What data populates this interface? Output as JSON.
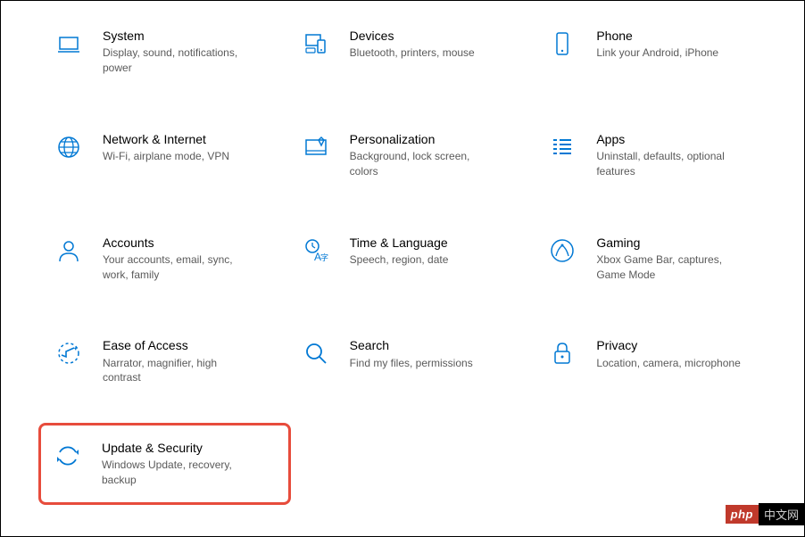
{
  "colors": {
    "iconBlue": "#0078d4",
    "highlightRed": "#e74c3c"
  },
  "watermark": {
    "left": "php",
    "right": "中文网"
  },
  "categories": [
    {
      "id": "system",
      "icon": "system-icon",
      "title": "System",
      "subtitle": "Display, sound, notifications, power"
    },
    {
      "id": "devices",
      "icon": "devices-icon",
      "title": "Devices",
      "subtitle": "Bluetooth, printers, mouse"
    },
    {
      "id": "phone",
      "icon": "phone-icon",
      "title": "Phone",
      "subtitle": "Link your Android, iPhone"
    },
    {
      "id": "network",
      "icon": "network-icon",
      "title": "Network & Internet",
      "subtitle": "Wi-Fi, airplane mode, VPN"
    },
    {
      "id": "personalization",
      "icon": "personalization-icon",
      "title": "Personalization",
      "subtitle": "Background, lock screen, colors"
    },
    {
      "id": "apps",
      "icon": "apps-icon",
      "title": "Apps",
      "subtitle": "Uninstall, defaults, optional features"
    },
    {
      "id": "accounts",
      "icon": "accounts-icon",
      "title": "Accounts",
      "subtitle": "Your accounts, email, sync, work, family"
    },
    {
      "id": "time-language",
      "icon": "time-language-icon",
      "title": "Time & Language",
      "subtitle": "Speech, region, date"
    },
    {
      "id": "gaming",
      "icon": "gaming-icon",
      "title": "Gaming",
      "subtitle": "Xbox Game Bar, captures, Game Mode"
    },
    {
      "id": "ease-of-access",
      "icon": "ease-of-access-icon",
      "title": "Ease of Access",
      "subtitle": "Narrator, magnifier, high contrast"
    },
    {
      "id": "search",
      "icon": "search-icon",
      "title": "Search",
      "subtitle": "Find my files, permissions"
    },
    {
      "id": "privacy",
      "icon": "privacy-icon",
      "title": "Privacy",
      "subtitle": "Location, camera, microphone"
    },
    {
      "id": "update-security",
      "icon": "update-security-icon",
      "title": "Update & Security",
      "subtitle": "Windows Update, recovery, backup",
      "highlighted": true
    }
  ]
}
